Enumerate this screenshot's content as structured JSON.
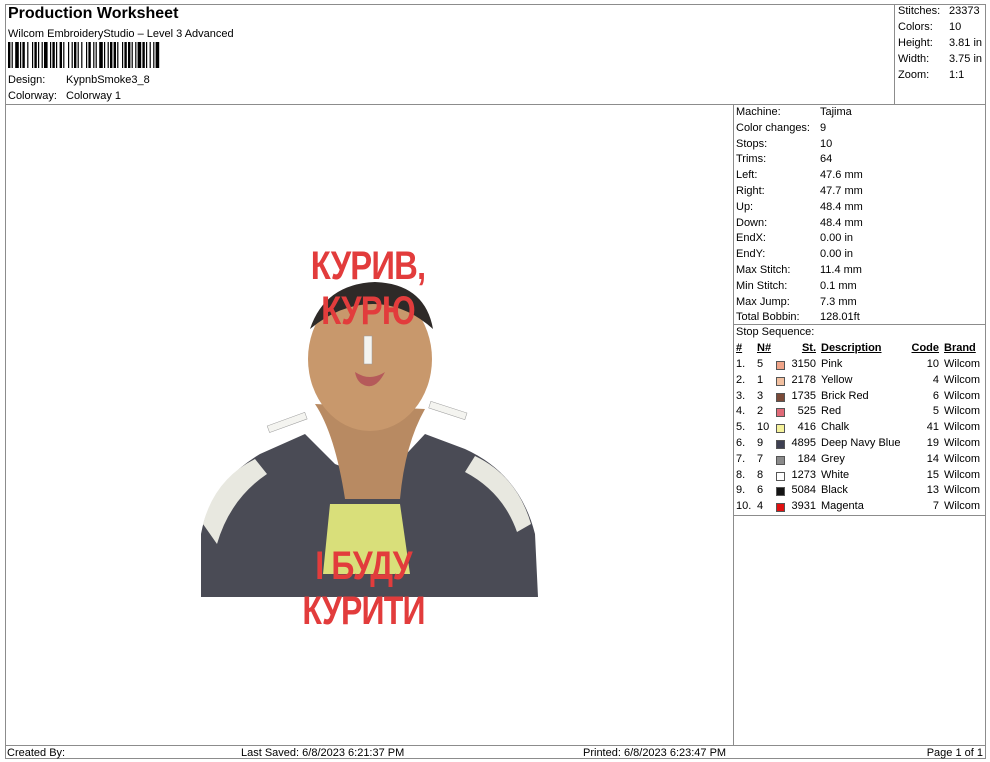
{
  "header": {
    "title": "Production Worksheet",
    "subtitle": "Wilcom EmbroideryStudio – Level 3 Advanced",
    "design_label": "Design:",
    "design_value": "KypnbSmoke3_8",
    "colorway_label": "Colorway:",
    "colorway_value": "Colorway 1"
  },
  "summary": [
    {
      "label": "Stitches:",
      "value": "23373"
    },
    {
      "label": "Colors:",
      "value": "10"
    },
    {
      "label": "Height:",
      "value": "3.81 in"
    },
    {
      "label": "Width:",
      "value": "3.75 in"
    },
    {
      "label": "Zoom:",
      "value": "1:1"
    }
  ],
  "artwork": {
    "top_text": "КУРИВ, КУРЮ",
    "bottom_text": "І БУДУ КУРИТИ"
  },
  "machine_info": [
    {
      "label": "Machine:",
      "value": "Tajima"
    },
    {
      "label": "Color changes:",
      "value": "9"
    },
    {
      "label": "Stops:",
      "value": "10"
    },
    {
      "label": "Trims:",
      "value": "64"
    },
    {
      "label": "Left:",
      "value": "47.6 mm"
    },
    {
      "label": "Right:",
      "value": "47.7 mm"
    },
    {
      "label": "Up:",
      "value": "48.4 mm"
    },
    {
      "label": "Down:",
      "value": "48.4 mm"
    },
    {
      "label": "EndX:",
      "value": "0.00 in"
    },
    {
      "label": "EndY:",
      "value": "0.00 in"
    },
    {
      "label": "Max Stitch:",
      "value": "11.4 mm"
    },
    {
      "label": "Min Stitch:",
      "value": "0.1 mm"
    },
    {
      "label": "Max Jump:",
      "value": "7.3 mm"
    },
    {
      "label": "Total Bobbin:",
      "value": "128.01ft"
    }
  ],
  "stop_sequence": {
    "title": "Stop Sequence:",
    "headers": {
      "num": "#",
      "n": "N#",
      "st": "St.",
      "desc": "Description",
      "code": "Code",
      "brand": "Brand"
    },
    "rows": [
      {
        "num": "1.",
        "n": "5",
        "color": "#f0a488",
        "st": "3150",
        "desc": "Pink",
        "code": "10",
        "brand": "Wilcom"
      },
      {
        "num": "2.",
        "n": "1",
        "color": "#f2c0a0",
        "st": "2178",
        "desc": "Yellow",
        "code": "4",
        "brand": "Wilcom"
      },
      {
        "num": "3.",
        "n": "3",
        "color": "#7a4a38",
        "st": "1735",
        "desc": "Brick Red",
        "code": "6",
        "brand": "Wilcom"
      },
      {
        "num": "4.",
        "n": "2",
        "color": "#e06a78",
        "st": "525",
        "desc": "Red",
        "code": "5",
        "brand": "Wilcom"
      },
      {
        "num": "5.",
        "n": "10",
        "color": "#f5f29a",
        "st": "416",
        "desc": "Chalk",
        "code": "41",
        "brand": "Wilcom"
      },
      {
        "num": "6.",
        "n": "9",
        "color": "#3e4052",
        "st": "4895",
        "desc": "Deep Navy Blue",
        "code": "19",
        "brand": "Wilcom"
      },
      {
        "num": "7.",
        "n": "7",
        "color": "#8a8a8a",
        "st": "184",
        "desc": "Grey",
        "code": "14",
        "brand": "Wilcom"
      },
      {
        "num": "8.",
        "n": "8",
        "color": "#ffffff",
        "st": "1273",
        "desc": "White",
        "code": "15",
        "brand": "Wilcom"
      },
      {
        "num": "9.",
        "n": "6",
        "color": "#141414",
        "st": "5084",
        "desc": "Black",
        "code": "13",
        "brand": "Wilcom"
      },
      {
        "num": "10.",
        "n": "4",
        "color": "#e01010",
        "st": "3931",
        "desc": "Magenta",
        "code": "7",
        "brand": "Wilcom"
      }
    ]
  },
  "footer": {
    "created_by": "Created By:",
    "last_saved": "Last Saved: 6/8/2023 6:21:37 PM",
    "printed": "Printed: 6/8/2023 6:23:47 PM",
    "page": "Page 1 of 1"
  }
}
